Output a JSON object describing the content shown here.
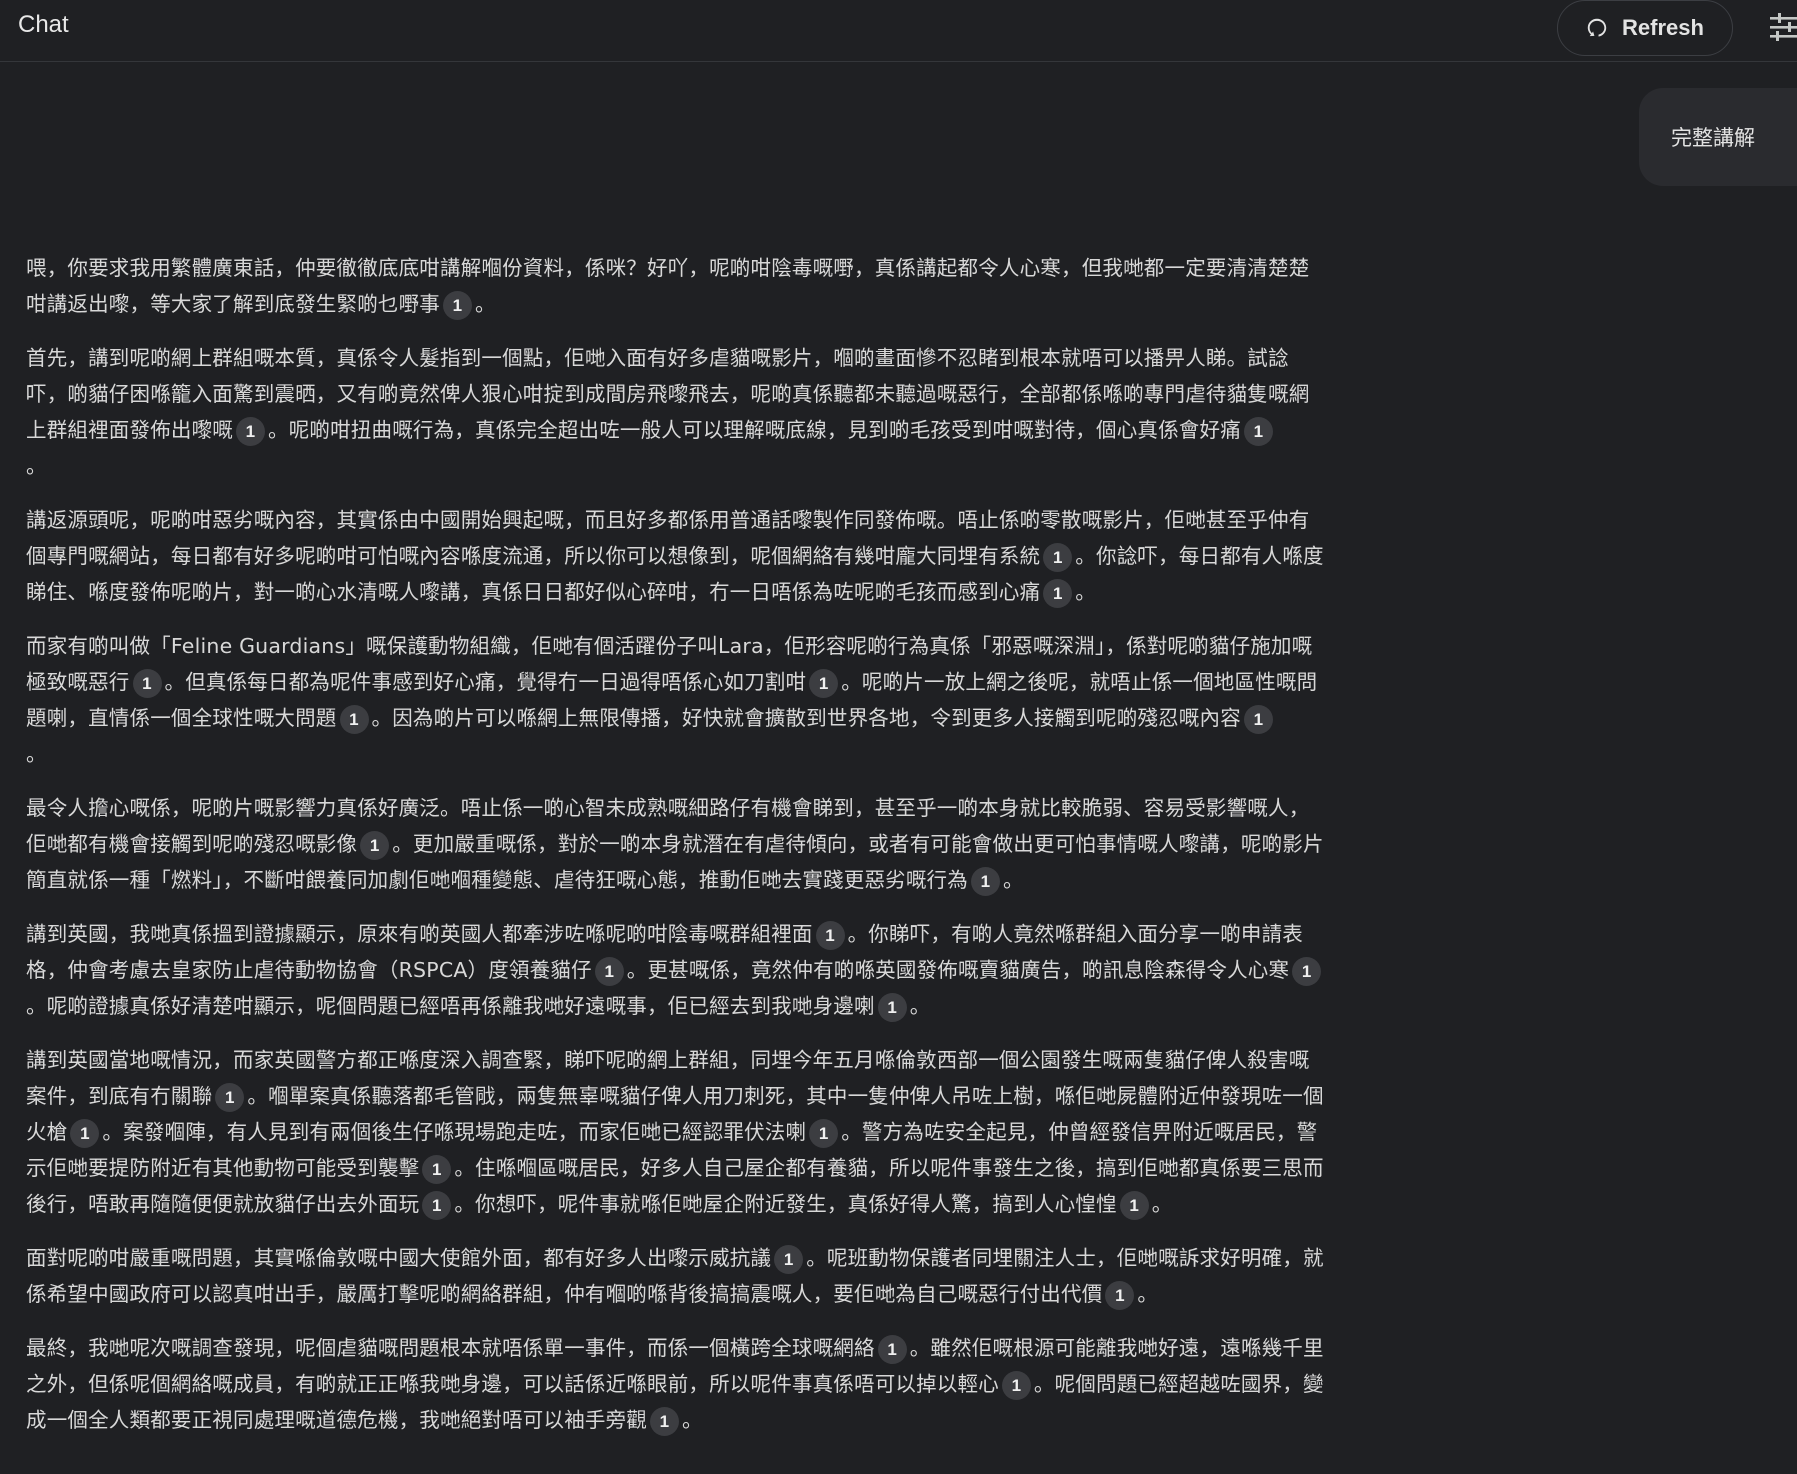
{
  "header": {
    "title": "Chat",
    "refresh_label": "Refresh"
  },
  "user_message": {
    "text": "完整講解"
  },
  "citation_label": "1",
  "paragraphs": [
    [
      {
        "t": "喂，你要求我用繁體廣東話，仲要徹徹底底咁講解嗰份資料，係咪？好吖，呢啲咁陰毒嘅嘢，真係講起都令人心寒，但我哋都一定要清清楚楚咁講返出嚟，等大家了解到底發生緊啲乜嘢事"
      },
      {
        "c": true
      },
      {
        "t": "。"
      }
    ],
    [
      {
        "t": "首先，講到呢啲網上群組嘅本質，真係令人髮指到一個點，佢哋入面有好多虐貓嘅影片，嗰啲畫面慘不忍睹到根本就唔可以播畀人睇。試諗吓，啲貓仔困喺籠入面驚到震晒，又有啲竟然俾人狠心咁掟到成間房飛嚟飛去，呢啲真係聽都未聽過嘅惡行，全部都係喺啲專門虐待貓隻嘅網上群組裡面發佈出嚟嘅"
      },
      {
        "c": true
      },
      {
        "t": "。呢啲咁扭曲嘅行為，真係完全超出咗一般人可以理解嘅底線，見到啲毛孩受到咁嘅對待，個心真係會好痛"
      },
      {
        "c": true
      },
      {
        "t": "。",
        "tail": true
      }
    ],
    [
      {
        "t": "講返源頭呢，呢啲咁惡劣嘅內容，其實係由中國開始興起嘅，而且好多都係用普通話嚟製作同發佈嘅。唔止係啲零散嘅影片，佢哋甚至乎仲有個專門嘅網站，每日都有好多呢啲咁可怕嘅內容喺度流通，所以你可以想像到，呢個網絡有幾咁龐大同埋有系統"
      },
      {
        "c": true
      },
      {
        "t": "。你諗吓，每日都有人喺度睇住、喺度發佈呢啲片，對一啲心水清嘅人嚟講，真係日日都好似心碎咁，冇一日唔係為咗呢啲毛孩而感到心痛"
      },
      {
        "c": true
      },
      {
        "t": "。"
      }
    ],
    [
      {
        "t": "而家有啲叫做「Feline Guardians」嘅保護動物組織，佢哋有個活躍份子叫Lara，佢形容呢啲行為真係「邪惡嘅深淵」，係對呢啲貓仔施加嘅極致嘅惡行"
      },
      {
        "c": true
      },
      {
        "t": "。但真係每日都為呢件事感到好心痛，覺得冇一日過得唔係心如刀割咁"
      },
      {
        "c": true
      },
      {
        "t": "。呢啲片一放上網之後呢，就唔止係一個地區性嘅問題喇，直情係一個全球性嘅大問題"
      },
      {
        "c": true
      },
      {
        "t": "。因為啲片可以喺網上無限傳播，好快就會擴散到世界各地，令到更多人接觸到呢啲殘忍嘅內容"
      },
      {
        "c": true
      },
      {
        "t": "。",
        "tail": true
      }
    ],
    [
      {
        "t": "最令人擔心嘅係，呢啲片嘅影響力真係好廣泛。唔止係一啲心智未成熟嘅細路仔有機會睇到，甚至乎一啲本身就比較脆弱、容易受影響嘅人，佢哋都有機會接觸到呢啲殘忍嘅影像"
      },
      {
        "c": true
      },
      {
        "t": "。更加嚴重嘅係，對於一啲本身就潛在有虐待傾向，或者有可能會做出更可怕事情嘅人嚟講，呢啲影片簡直就係一種「燃料」，不斷咁餵養同加劇佢哋嗰種變態、虐待狂嘅心態，推動佢哋去實踐更惡劣嘅行為"
      },
      {
        "c": true
      },
      {
        "t": "。"
      }
    ],
    [
      {
        "t": "講到英國，我哋真係搵到證據顯示，原來有啲英國人都牽涉咗喺呢啲咁陰毒嘅群組裡面"
      },
      {
        "c": true
      },
      {
        "t": "。你睇吓，有啲人竟然喺群組入面分享一啲申請表格，仲會考慮去皇家防止虐待動物協會（RSPCA）度領養貓仔"
      },
      {
        "c": true
      },
      {
        "t": "。更甚嘅係，竟然仲有啲喺英國發佈嘅賣貓廣告，啲訊息陰森得令人心寒"
      },
      {
        "c": true
      },
      {
        "t": "。呢啲證據真係好清楚咁顯示，呢個問題已經唔再係離我哋好遠嘅事，佢已經去到我哋身邊喇"
      },
      {
        "c": true
      },
      {
        "t": "。"
      }
    ],
    [
      {
        "t": "講到英國當地嘅情況，而家英國警方都正喺度深入調查緊，睇吓呢啲網上群組，同埋今年五月喺倫敦西部一個公園發生嘅兩隻貓仔俾人殺害嘅案件，到底有冇關聯"
      },
      {
        "c": true
      },
      {
        "t": "。嗰單案真係聽落都毛管戙，兩隻無辜嘅貓仔俾人用刀刺死，其中一隻仲俾人吊咗上樹，喺佢哋屍體附近仲發現咗一個火槍"
      },
      {
        "c": true
      },
      {
        "t": "。案發嗰陣，有人見到有兩個後生仔喺現場跑走咗，而家佢哋已經認罪伏法喇"
      },
      {
        "c": true
      },
      {
        "t": "。警方為咗安全起見，仲曾經發信畀附近嘅居民，警示佢哋要提防附近有其他動物可能受到襲擊"
      },
      {
        "c": true
      },
      {
        "t": "。住喺嗰區嘅居民，好多人自己屋企都有養貓，所以呢件事發生之後，搞到佢哋都真係要三思而後行，唔敢再隨隨便便就放貓仔出去外面玩"
      },
      {
        "c": true
      },
      {
        "t": "。你想吓，呢件事就喺佢哋屋企附近發生，真係好得人驚，搞到人心惶惶"
      },
      {
        "c": true
      },
      {
        "t": "。"
      }
    ],
    [
      {
        "t": "面對呢啲咁嚴重嘅問題，其實喺倫敦嘅中國大使館外面，都有好多人出嚟示威抗議"
      },
      {
        "c": true
      },
      {
        "t": "。呢班動物保護者同埋關注人士，佢哋嘅訴求好明確，就係希望中國政府可以認真咁出手，嚴厲打擊呢啲網絡群組，仲有嗰啲喺背後搞搞震嘅人，要佢哋為自己嘅惡行付出代價"
      },
      {
        "c": true
      },
      {
        "t": "。"
      }
    ],
    [
      {
        "t": "最終，我哋呢次嘅調查發現，呢個虐貓嘅問題根本就唔係單一事件，而係一個橫跨全球嘅網絡"
      },
      {
        "c": true
      },
      {
        "t": "。雖然佢嘅根源可能離我哋好遠，遠喺幾千里之外，但係呢個網絡嘅成員，有啲就正正喺我哋身邊，可以話係近喺眼前，所以呢件事真係唔可以掉以輕心"
      },
      {
        "c": true
      },
      {
        "t": "。呢個問題已經超越咗國界，變成一個全人類都要正視同處理嘅道德危機，我哋絕對唔可以袖手旁觀"
      },
      {
        "c": true
      },
      {
        "t": "。"
      }
    ]
  ],
  "colors": {
    "background": "#1f2023",
    "text": "#d8d8d8",
    "citation_chip": "#3c3d41",
    "user_bubble": "#2a2b2f"
  },
  "icons": {
    "refresh": "refresh-icon",
    "settings": "tune-icon"
  }
}
